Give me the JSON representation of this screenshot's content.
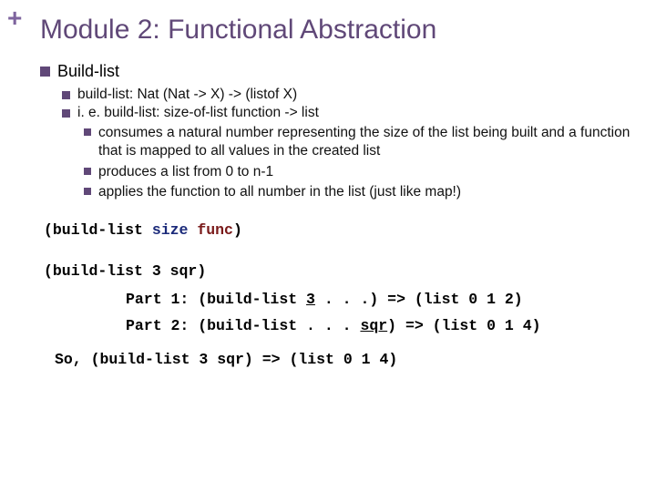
{
  "decor": {
    "plus": "+"
  },
  "title": "Module 2: Functional Abstraction",
  "bullets": {
    "l1": "Build-list",
    "l2a": "build-list: Nat (Nat -> X) -> (listof X)",
    "l2b": "i. e. build-list: size-of-list function -> list",
    "l3a": "consumes a natural number representing the size of the list being built and a function that is mapped to all values in the created list",
    "l3b": "produces a list from 0 to n-1",
    "l3c": "applies the function to all number in the list (just like map!)"
  },
  "proto": {
    "open": "(build-list ",
    "size": "size",
    "space": " ",
    "func": "func",
    "close": ")"
  },
  "ex": {
    "call": "(build-list 3 sqr)",
    "p1label": "Part 1: ",
    "p1pre": "(build-list ",
    "p1arg": "3",
    "p1post": " . . .) => (list 0 1 2)",
    "p2label": "Part 2: ",
    "p2pre": "(build-list . . . ",
    "p2arg": "sqr",
    "p2post": ") => (list 0 1 4)",
    "so": "So, (build-list 3 sqr) => (list 0 1 4)"
  }
}
